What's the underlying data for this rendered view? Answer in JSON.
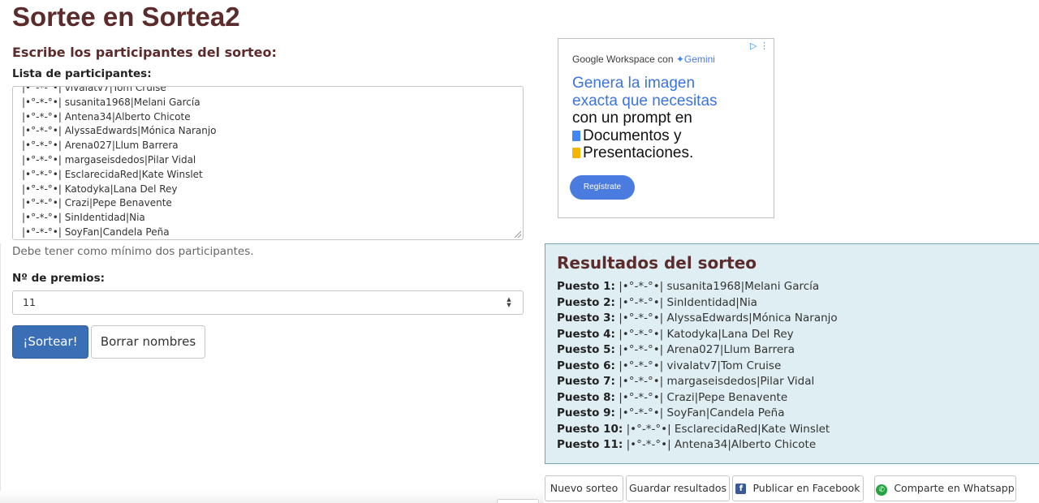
{
  "page_title": "Sortee en Sortea2",
  "form": {
    "heading": "Escribe los participantes del sorteo:",
    "list_label": "Lista de participantes:",
    "participants": [
      "|•°-*-°•| vivalatv7|Tom Cruise",
      "|•°-*-°•| susanita1968|Melani García",
      "|•°-*-°•| Antena34|Alberto Chicote",
      "|•°-*-°•| AlyssaEdwards|Mónica Naranjo",
      "|•°-*-°•| Arena027|Llum Barrera",
      "|•°-*-°•| margaseisdedos|Pilar Vidal",
      "|•°-*-°•| EsclarecidaRed|Kate Winslet",
      "|•°-*-°•| Katodyka|Lana Del Rey",
      "|•°-*-°•| Crazi|Pepe Benavente",
      "|•°-*-°•| SinIdentidad|Nia",
      "|•°-*-°•| SoyFan|Candela Peña"
    ],
    "hint": "Debe tener como mínimo dos participantes.",
    "prizes_label": "Nº de premios:",
    "prizes_value": "11",
    "draw_button": "¡Sortear!",
    "clear_button": "Borrar nombres"
  },
  "ad": {
    "brand_prefix": "Google Workspace con",
    "brand_suffix": "Gemini",
    "line1": "Genera la imagen",
    "line2": "exacta que necesitas",
    "line3": "con un prompt en",
    "line4": "Documentos y",
    "line5": "Presentaciones.",
    "cta": "Regístrate",
    "icons": {
      "ad_choices": "ad-choices-icon",
      "star": "gemini-star-icon"
    },
    "colors": {
      "blue_text": "#3b73e2",
      "cta_bg": "#4a7bde"
    }
  },
  "results": {
    "title": "Resultados del sorteo",
    "items": [
      {
        "label": "Puesto 1:",
        "value": "|•°-*-°•| susanita1968|Melani García"
      },
      {
        "label": "Puesto 2:",
        "value": "|•°-*-°•| SinIdentidad|Nia"
      },
      {
        "label": "Puesto 3:",
        "value": "|•°-*-°•| AlyssaEdwards|Mónica Naranjo"
      },
      {
        "label": "Puesto 4:",
        "value": "|•°-*-°•| Katodyka|Lana Del Rey"
      },
      {
        "label": "Puesto 5:",
        "value": "|•°-*-°•| Arena027|Llum Barrera"
      },
      {
        "label": "Puesto 6:",
        "value": "|•°-*-°•| vivalatv7|Tom Cruise"
      },
      {
        "label": "Puesto 7:",
        "value": "|•°-*-°•| margaseisdedos|Pilar Vidal"
      },
      {
        "label": "Puesto 8:",
        "value": "|•°-*-°•| Crazi|Pepe Benavente"
      },
      {
        "label": "Puesto 9:",
        "value": "|•°-*-°•| SoyFan|Candela Peña"
      },
      {
        "label": "Puesto 10:",
        "value": "|•°-*-°•| EsclarecidaRed|Kate Winslet"
      },
      {
        "label": "Puesto 11:",
        "value": "|•°-*-°•| Antena34|Alberto Chicote"
      }
    ]
  },
  "actions": {
    "new_draw": "Nuevo sorteo",
    "save_results": "Guardar resultados",
    "facebook": "Publicar en Facebook",
    "whatsapp": "Comparte en Whatsapp"
  },
  "colors": {
    "title": "#5c2b2b",
    "primary_button": "#3a6fb6",
    "results_bg": "#dfeef3",
    "results_border": "#7aa3b8"
  }
}
